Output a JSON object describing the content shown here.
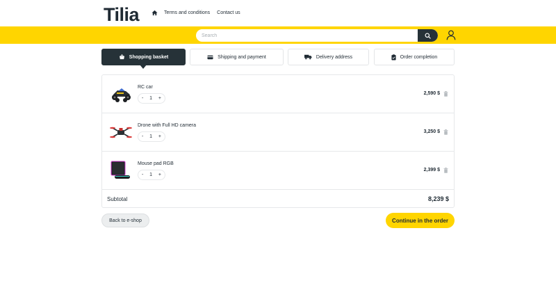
{
  "header": {
    "logo_text": "Tilia",
    "nav": {
      "home_icon": "home-icon",
      "terms": "Terms and conditions",
      "contact": "Contact us"
    }
  },
  "search": {
    "placeholder": "Search",
    "button_icon": "search-icon"
  },
  "account": {
    "icon": "user-icon"
  },
  "steps": [
    {
      "label": "Shopping basket",
      "icon": "basket-icon",
      "active": true
    },
    {
      "label": "Shipping and payment",
      "icon": "card-icon",
      "active": false
    },
    {
      "label": "Delivery address",
      "icon": "truck-icon",
      "active": false
    },
    {
      "label": "Order completion",
      "icon": "clipboard-icon",
      "active": false
    }
  ],
  "basket": {
    "items": [
      {
        "name": "RC car",
        "qty": "1",
        "price": "2,590 $",
        "icon": "rc-car-image"
      },
      {
        "name": "Drone with Full HD camera",
        "qty": "1",
        "price": "3,250 $",
        "icon": "drone-image"
      },
      {
        "name": "Mouse pad RGB",
        "qty": "1",
        "price": "2,399 $",
        "icon": "mouse-pad-image"
      }
    ],
    "qty_minus": "-",
    "qty_plus": "+",
    "subtotal_label": "Subtotal",
    "subtotal_value": "8,239 $"
  },
  "actions": {
    "back": "Back to e-shop",
    "continue": "Continue in the order"
  },
  "colors": {
    "accent": "#ffd500",
    "dark": "#263238"
  }
}
